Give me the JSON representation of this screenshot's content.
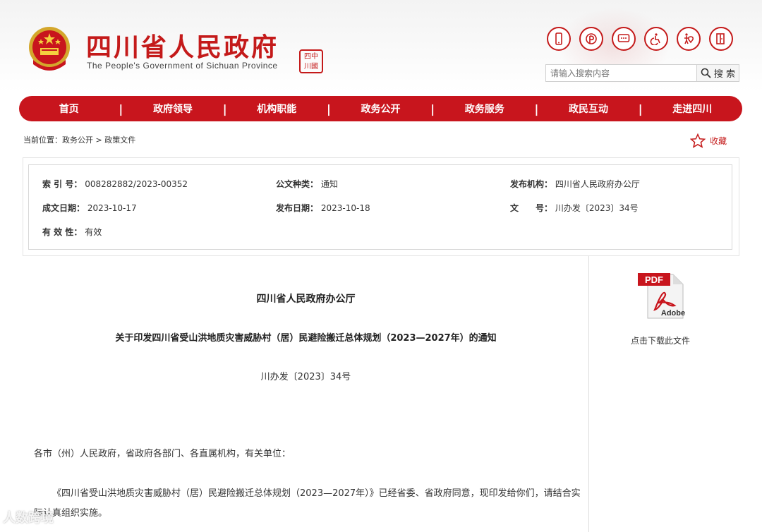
{
  "header": {
    "title": "四川省人民政府",
    "subtitle": "The People's Government of Sichuan Province",
    "seal_text": "四中川國"
  },
  "tools": [
    {
      "name": "mobile-icon"
    },
    {
      "name": "weibo-icon"
    },
    {
      "name": "message-icon"
    },
    {
      "name": "accessibility-icon"
    },
    {
      "name": "elder-care-icon"
    },
    {
      "name": "exit-icon"
    }
  ],
  "search": {
    "placeholder": "请输入搜索内容",
    "button": "搜 索"
  },
  "nav": [
    "首页",
    "政府领导",
    "机构职能",
    "政务公开",
    "政务服务",
    "政民互动",
    "走进四川"
  ],
  "breadcrumb": {
    "prefix": "当前位置：",
    "path": "政务公开 > 政策文件"
  },
  "favorite": "收藏",
  "meta": {
    "index_label": "索 引 号：",
    "index_value": "008282882/2023-00352",
    "type_label": "公文种类：",
    "type_value": "通知",
    "org_label": "发布机构：",
    "org_value": "四川省人民政府办公厅",
    "created_label": "成文日期：",
    "created_value": "2023-10-17",
    "published_label": "发布日期：",
    "published_value": "2023-10-18",
    "docno_label": "文　　号：",
    "docno_value": "川办发〔2023〕34号",
    "validity_label": "有 效 性：",
    "validity_value": "有效"
  },
  "document": {
    "issuer": "四川省人民政府办公厅",
    "title": "关于印发四川省受山洪地质灾害威胁村（居）民避险搬迁总体规划（2023—2027年）的通知",
    "number": "川办发〔2023〕34号",
    "salutation": "各市（州）人民政府，省政府各部门、各直属机构，有关单位：",
    "body": "《四川省受山洪地质灾害威胁村（居）民避险搬迁总体规划（2023—2027年）》已经省委、省政府同意，现印发给你们，请结合实际认真组织实施。"
  },
  "side": {
    "pdf_badge": "PDF",
    "pdf_brand": "Adobe",
    "download_label": "点击下载此文件"
  },
  "watermark": "人数跨境",
  "colors": {
    "brand_red": "#c8151d",
    "accent_red": "#c41a1a"
  }
}
